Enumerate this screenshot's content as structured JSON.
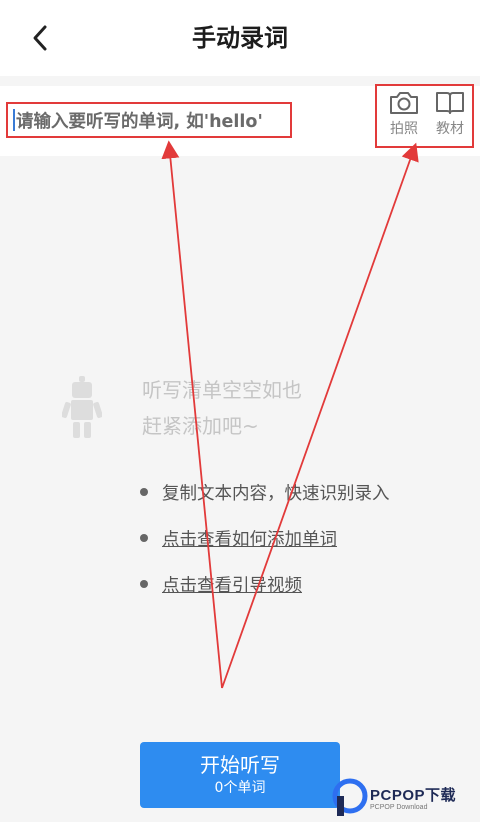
{
  "header": {
    "title": "手动录词"
  },
  "input": {
    "placeholder": "请输入要听写的单词, 如'hello'"
  },
  "tools": [
    {
      "label": "拍照",
      "icon": "camera-icon"
    },
    {
      "label": "教材",
      "icon": "book-icon"
    }
  ],
  "empty_state": {
    "line1": "听写清单空空如也",
    "line2": "赶紧添加吧~"
  },
  "tips": [
    {
      "text": "复制文本内容，快速识别录入"
    },
    {
      "text": "点击查看如何添加单词"
    },
    {
      "text": "点击查看引导视频"
    }
  ],
  "start_button": {
    "label": "开始听写",
    "count": "0个单词"
  },
  "watermark": {
    "brand": "PCPOP下载",
    "sub": "PCPOP Download"
  },
  "colors": {
    "accent": "#2e8cf0",
    "annotation": "#e23a3a"
  }
}
